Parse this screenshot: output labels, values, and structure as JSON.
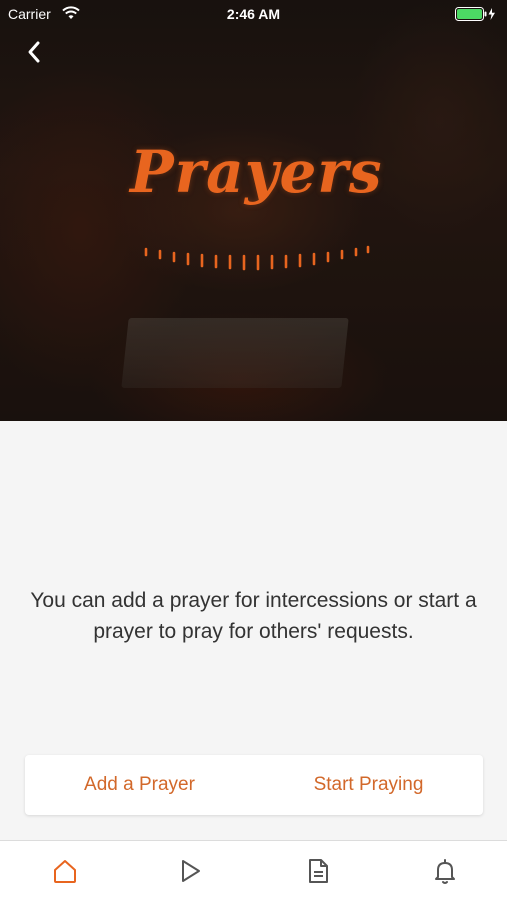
{
  "status_bar": {
    "carrier": "Carrier",
    "time": "2:46 AM",
    "wifi_icon": "wifi-icon",
    "battery_icon": "battery-charging-icon"
  },
  "header": {
    "back_icon": "chevron-left-icon",
    "title": "Prayers"
  },
  "main": {
    "description": "You can add a prayer for intercessions or start a prayer to pray for others' requests."
  },
  "actions": {
    "add_label": "Add a Prayer",
    "start_label": "Start Praying"
  },
  "tab_bar": {
    "tabs": [
      {
        "icon": "home-icon",
        "active": true
      },
      {
        "icon": "play-icon",
        "active": false
      },
      {
        "icon": "document-icon",
        "active": false
      },
      {
        "icon": "bell-icon",
        "active": false
      }
    ]
  },
  "colors": {
    "accent": "#e8651f",
    "action_text": "#d2682a",
    "battery": "#4cd964",
    "inactive_icon": "#555555"
  }
}
